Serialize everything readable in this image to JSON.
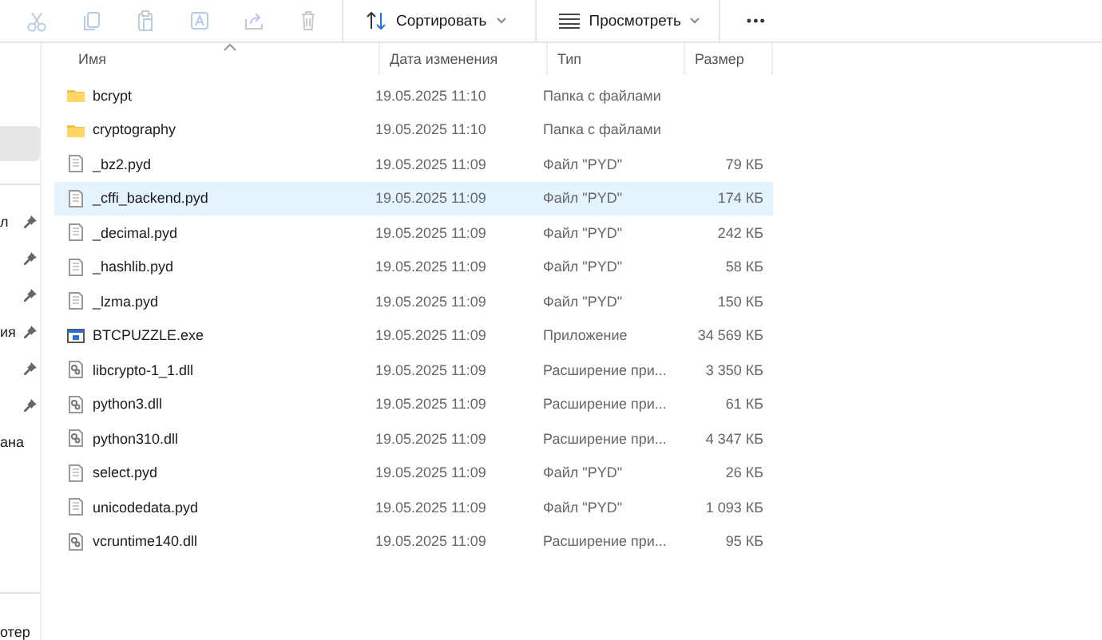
{
  "toolbar": {
    "actions": [
      {
        "kind": "cut",
        "disabled": true
      },
      {
        "kind": "copy",
        "disabled": true
      },
      {
        "kind": "paste",
        "disabled": true
      },
      {
        "kind": "rename",
        "disabled": true
      },
      {
        "kind": "share",
        "disabled": true
      },
      {
        "kind": "delete",
        "disabled": true
      }
    ],
    "menus": [
      {
        "kind": "sort",
        "label": "Сортировать"
      },
      {
        "kind": "view",
        "label": "Просмотреть"
      }
    ],
    "more": "•••"
  },
  "sidebar": {
    "sections": [
      [
        {
          "selected": true,
          "pinned": false
        }
      ],
      [
        {
          "label": "л",
          "selected": false,
          "pinned": true
        },
        {
          "selected": false,
          "pinned": true
        },
        {
          "selected": false,
          "pinned": true
        },
        {
          "label": "ия",
          "selected": false,
          "pinned": true
        },
        {
          "selected": false,
          "pinned": true
        },
        {
          "selected": false,
          "pinned": true
        },
        {
          "label": "ана",
          "selected": false,
          "pinned": false
        }
      ],
      [
        {
          "label": "отер",
          "selected": false,
          "pinned": false
        }
      ]
    ]
  },
  "table": {
    "columns": [
      "Имя",
      "Дата изменения",
      "Тип",
      "Размер"
    ],
    "rows": [
      {
        "kind": "folder",
        "name": "bcrypt",
        "date": "19.05.2025 11:10",
        "type": "Папка с файлами",
        "selected": false
      },
      {
        "kind": "folder",
        "name": "cryptography",
        "date": "19.05.2025 11:10",
        "type": "Папка с файлами",
        "selected": false
      },
      {
        "kind": "file",
        "name": "_bz2.pyd",
        "date": "19.05.2025 11:09",
        "type": "Файл \"PYD\"",
        "size": "79 КБ",
        "selected": false
      },
      {
        "kind": "file",
        "name": "_cffi_backend.pyd",
        "date": "19.05.2025 11:09",
        "type": "Файл \"PYD\"",
        "size": "174 КБ",
        "selected": true
      },
      {
        "kind": "file",
        "name": "_decimal.pyd",
        "date": "19.05.2025 11:09",
        "type": "Файл \"PYD\"",
        "size": "242 КБ",
        "selected": false
      },
      {
        "kind": "file",
        "name": "_hashlib.pyd",
        "date": "19.05.2025 11:09",
        "type": "Файл \"PYD\"",
        "size": "58 КБ",
        "selected": false
      },
      {
        "kind": "file",
        "name": "_lzma.pyd",
        "date": "19.05.2025 11:09",
        "type": "Файл \"PYD\"",
        "size": "150 КБ",
        "selected": false
      },
      {
        "kind": "exe",
        "name": "BTCPUZZLE.exe",
        "date": "19.05.2025 11:09",
        "type": "Приложение",
        "size": "34 569 КБ",
        "selected": false
      },
      {
        "kind": "dll",
        "name": "libcrypto-1_1.dll",
        "date": "19.05.2025 11:09",
        "type": "Расширение при...",
        "size": "3 350 КБ",
        "selected": false
      },
      {
        "kind": "dll",
        "name": "python3.dll",
        "date": "19.05.2025 11:09",
        "type": "Расширение при...",
        "size": "61 КБ",
        "selected": false
      },
      {
        "kind": "dll",
        "name": "python310.dll",
        "date": "19.05.2025 11:09",
        "type": "Расширение при...",
        "size": "4 347 КБ",
        "selected": false
      },
      {
        "kind": "file",
        "name": "select.pyd",
        "date": "19.05.2025 11:09",
        "type": "Файл \"PYD\"",
        "size": "26 КБ",
        "selected": false
      },
      {
        "kind": "file",
        "name": "unicodedata.pyd",
        "date": "19.05.2025 11:09",
        "type": "Файл \"PYD\"",
        "size": "1 093 КБ",
        "selected": false
      },
      {
        "kind": "dll",
        "name": "vcruntime140.dll",
        "date": "19.05.2025 11:09",
        "type": "Расширение при...",
        "size": "95 КБ",
        "selected": false
      }
    ]
  }
}
